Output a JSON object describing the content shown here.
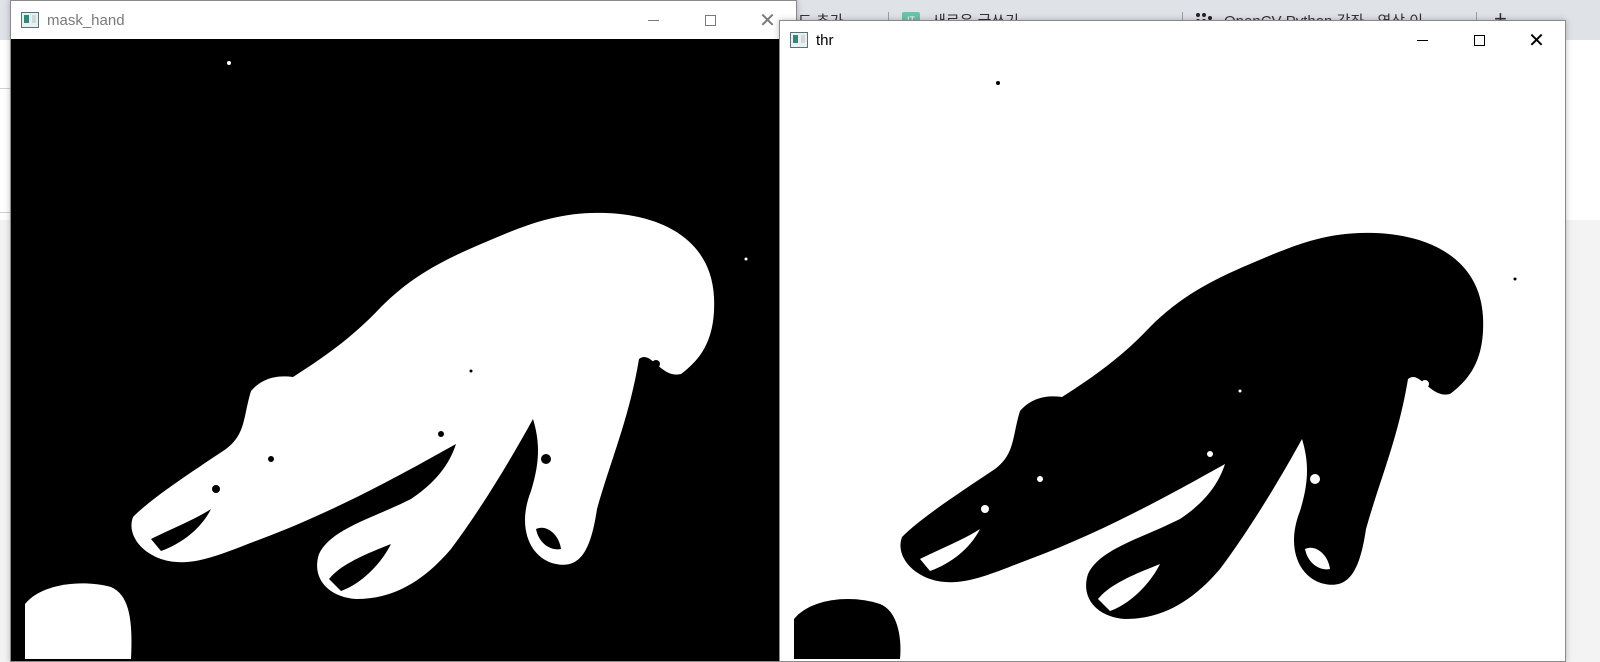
{
  "browser": {
    "tabs": [
      {
        "label": "드 추가",
        "close": "⌄"
      },
      {
        "label": "새로운 글쓰기",
        "icon": "green-app-icon",
        "close": "⌄"
      },
      {
        "label": "OpenCV-Python 강좌 - 영상 이",
        "icon": "dots-logo-icon",
        "close": "⌄"
      }
    ],
    "new_tab": "+"
  },
  "windows": [
    {
      "title": "mask_hand",
      "state": "inactive",
      "title_color": "#7a7a7a",
      "image": "white-hand-on-black"
    },
    {
      "title": "thr",
      "state": "active",
      "title_color": "#000000",
      "image": "black-hand-on-white"
    }
  ],
  "controls": {
    "minimize": "",
    "maximize": "",
    "close": "✕"
  }
}
